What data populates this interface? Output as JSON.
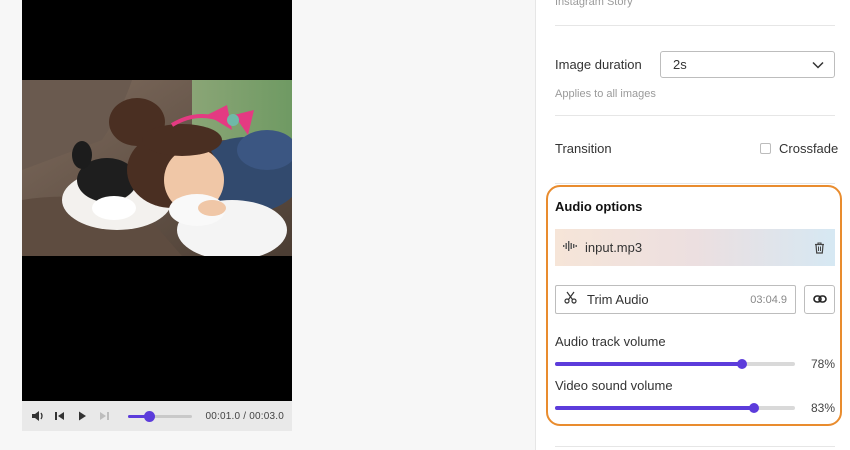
{
  "colors": {
    "accent": "#5c3cdb",
    "highlight_border": "#e98c2e"
  },
  "player": {
    "time_current": "00:01.0",
    "time_total": "00:03.0",
    "time_separator": " / ",
    "progress": 0.33,
    "buttons": [
      "volume-icon",
      "previous-icon",
      "play-icon",
      "next-icon"
    ]
  },
  "settings": {
    "preset_label": "Instagram Story",
    "image_duration": {
      "label": "Image duration",
      "value": "2s",
      "hint": "Applies to all images"
    },
    "transition": {
      "label": "Transition",
      "option_label": "Crossfade",
      "checked": false
    },
    "audio": {
      "title": "Audio options",
      "file_name": "input.mp3",
      "trim_label": "Trim Audio",
      "trim_duration": "03:04.9",
      "track_volume": {
        "label": "Audio track volume",
        "percent": 78,
        "value_text": "78%"
      },
      "video_volume": {
        "label": "Video sound volume",
        "percent": 83,
        "value_text": "83%"
      }
    }
  }
}
